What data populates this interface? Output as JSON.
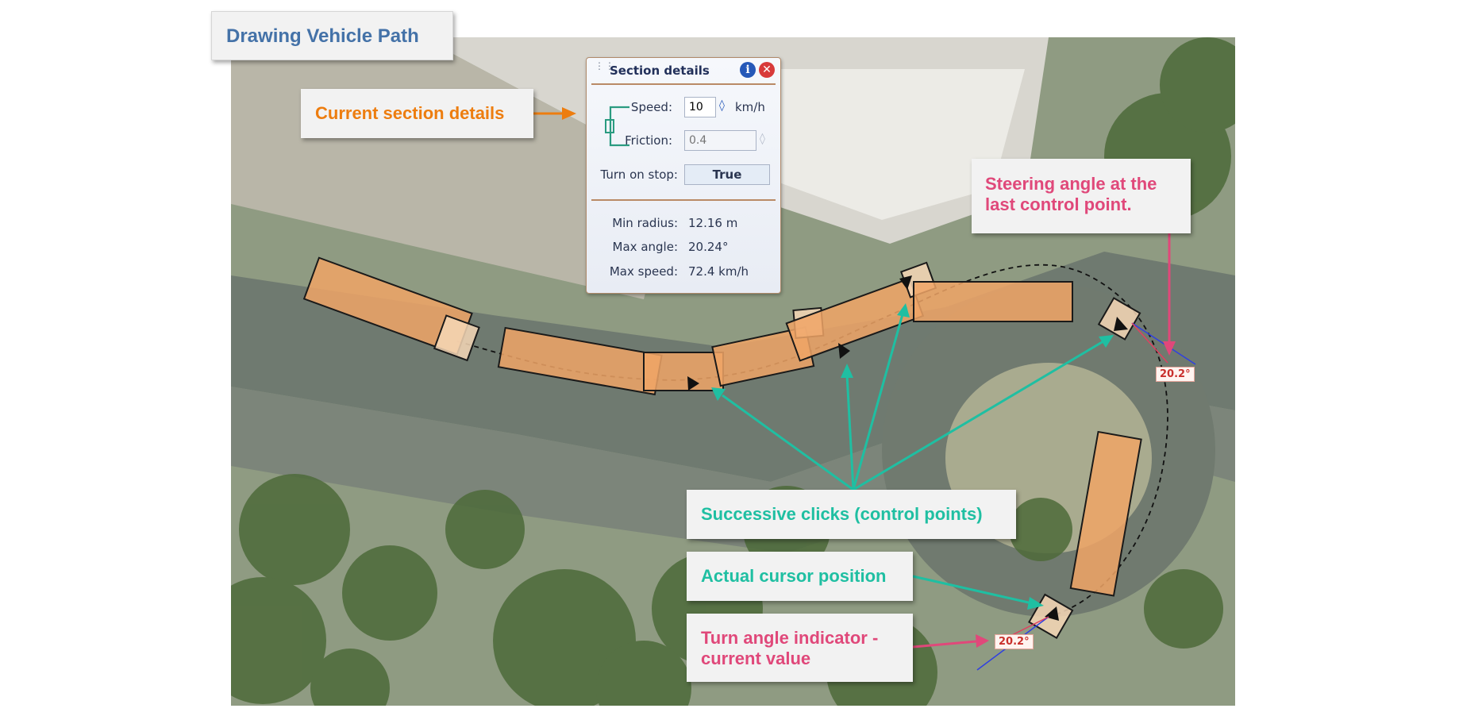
{
  "title": "Drawing Vehicle Path",
  "callouts": {
    "section": "Current section details",
    "steering": "Steering angle at the last control point.",
    "clicks": "Successive clicks (control points)",
    "cursor": "Actual cursor position",
    "turn": "Turn angle indicator - current value"
  },
  "angle_labels": [
    "20.2°",
    "20.2°"
  ],
  "panel": {
    "title": "Section details",
    "speed_label": "Speed:",
    "speed_value": "10",
    "speed_unit": "km/h",
    "friction_label": "Friction:",
    "friction_placeholder": "0.4",
    "turn_on_stop_label": "Turn on stop:",
    "turn_on_stop_value": "True",
    "min_radius_label": "Min radius:",
    "min_radius_value": "12.16 m",
    "max_angle_label": "Max angle:",
    "max_angle_value": "20.24°",
    "max_speed_label": "Max speed:",
    "max_speed_value": "72.4 km/h"
  },
  "icons": [
    "drag-grip-icon",
    "info-icon",
    "close-icon",
    "spinner-icon",
    "link-bracket-icon"
  ],
  "colors": {
    "title": "#4472a8",
    "orange_callout": "#ed7d0f",
    "teal_callout": "#1fbfa2",
    "pink_callout": "#e0487a",
    "vehicle": "#f0a466"
  }
}
